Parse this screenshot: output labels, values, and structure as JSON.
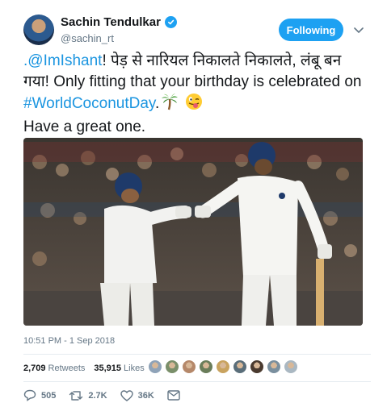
{
  "author": {
    "name": "Sachin Tendulkar",
    "handle": "@sachin_rt",
    "verified_icon": "verified-badge-icon"
  },
  "follow_button": {
    "label": "Following"
  },
  "tweet": {
    "mention": ".@ImIshant",
    "text_hindi": "! पेड़ से नारियल निकालते निकालते, लंबू बन गया! Only fitting that your birthday is celebrated on ",
    "hashtag": "#WorldCoconutDay",
    "after_hashtag": ".",
    "emojis": [
      "palm-tree-icon",
      "winking-tongue-face-icon"
    ],
    "line_last": "Have a great one."
  },
  "photo": {
    "description_icon": "cricket-photo"
  },
  "timestamp": "10:51 PM - 1 Sep 2018",
  "stats": {
    "retweets_count": "2,709",
    "retweets_label": "Retweets",
    "likes_count": "35,915",
    "likes_label": "Likes",
    "liker_colors": [
      "#8fa3b8",
      "#7a8f6a",
      "#b5886a",
      "#6a7d5a",
      "#c9a35f",
      "#5a6e7a",
      "#4a3a2f",
      "#7a8f9e",
      "#aab8c2"
    ]
  },
  "actions": {
    "reply_count": "505",
    "retweet_count": "2.7K",
    "like_count": "36K"
  },
  "colors": {
    "accent": "#1da1f2",
    "link": "#1b95e0",
    "secondary_text": "#657786"
  }
}
